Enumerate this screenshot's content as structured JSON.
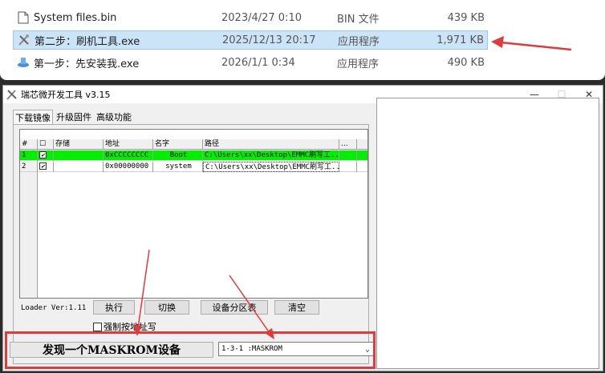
{
  "explorer": {
    "files": [
      {
        "name": "System files.bin",
        "date": "2023/4/27 0:10",
        "type": "BIN 文件",
        "size": "439 KB",
        "icon": "document-icon",
        "selected": false
      },
      {
        "name": "第二步：刷机工具.exe",
        "date": "2025/12/13 20:17",
        "type": "应用程序",
        "size": "1,971 KB",
        "icon": "tools-icon",
        "selected": true
      },
      {
        "name": "第一步：先安装我.exe",
        "date": "2026/1/1 0:34",
        "type": "应用程序",
        "size": "490 KB",
        "icon": "installer-icon",
        "selected": false
      }
    ]
  },
  "window": {
    "title": "瑞芯微开发工具 v3.15",
    "controls": {
      "minimize": "—",
      "maximize": "☐",
      "close": "✕"
    }
  },
  "tabs": [
    "下载镜像",
    "升级固件",
    "高级功能"
  ],
  "table": {
    "columns": [
      "#",
      "☐",
      "存储",
      "地址",
      "名字",
      "路径",
      "..."
    ],
    "rows": [
      {
        "num": "1",
        "checked": "✔",
        "storage": "",
        "address": "0xCCCCCCCC",
        "name": "Boot",
        "path": "C:\\Users\\xx\\Desktop\\EMMC刷写工..."
      },
      {
        "num": "2",
        "checked": "✔",
        "storage": "",
        "address": "0x00000000",
        "name": "system",
        "path": "C:\\Users\\xx\\Desktop\\EMMC刷写工..."
      }
    ]
  },
  "loader_version": "Loader Ver:1.11",
  "buttons": {
    "run": "执行",
    "switch": "切换",
    "partition_table": "设备分区表",
    "clear": "清空"
  },
  "force_address_label": "强制按地址写",
  "status_text": "发现一个MASKROM设备",
  "device_select_value": "1-3-1 :MASKROM",
  "colors": {
    "highlight_row": "#00f000",
    "annotation_red": "#e03a3a",
    "selection_blue": "#cce4f7"
  }
}
